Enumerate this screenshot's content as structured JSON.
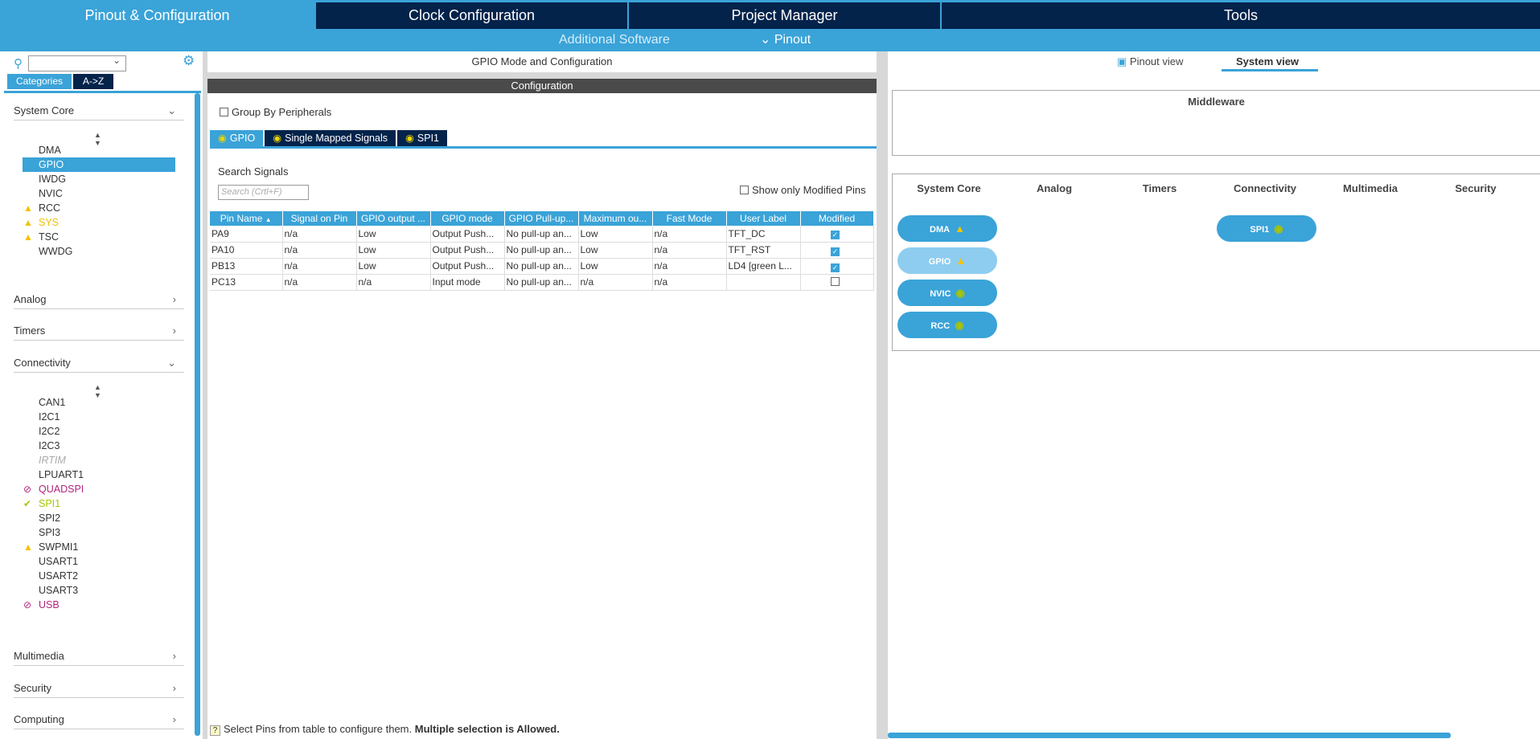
{
  "topnav": {
    "tabs": [
      "Pinout & Configuration",
      "Clock Configuration",
      "Project Manager",
      "Tools"
    ],
    "sub_additional": "Additional Software",
    "sub_pinout": "Pinout"
  },
  "left": {
    "categories_btn": "Categories",
    "az_btn": "A->Z",
    "system_core": {
      "label": "System Core",
      "items": [
        "DMA",
        "GPIO",
        "IWDG",
        "NVIC",
        "RCC",
        "SYS",
        "TSC",
        "WWDG"
      ]
    },
    "analog": "Analog",
    "timers": "Timers",
    "connectivity": {
      "label": "Connectivity",
      "items": [
        "CAN1",
        "I2C1",
        "I2C2",
        "I2C3",
        "IRTIM",
        "LPUART1",
        "QUADSPI",
        "SPI1",
        "SPI2",
        "SPI3",
        "SWPMI1",
        "USART1",
        "USART2",
        "USART3",
        "USB"
      ]
    },
    "multimedia": "Multimedia",
    "security": "Security",
    "computing": "Computing"
  },
  "mid": {
    "title": "GPIO Mode and Configuration",
    "config": "Configuration",
    "group_by": "Group By Peripherals",
    "tabs": [
      "GPIO",
      "Single Mapped Signals",
      "SPI1"
    ],
    "search_label": "Search Signals",
    "search_placeholder": "Search (Crtl+F)",
    "modified_only": "Show only Modified Pins",
    "columns": [
      "Pin Name",
      "Signal on Pin",
      "GPIO output ...",
      "GPIO mode",
      "GPIO Pull-up...",
      "Maximum ou...",
      "Fast Mode",
      "User Label",
      "Modified"
    ],
    "rows": [
      [
        "PA9",
        "n/a",
        "Low",
        "Output Push...",
        "No pull-up an...",
        "Low",
        "n/a",
        "TFT_DC"
      ],
      [
        "PA10",
        "n/a",
        "Low",
        "Output Push...",
        "No pull-up an...",
        "Low",
        "n/a",
        "TFT_RST"
      ],
      [
        "PB13",
        "n/a",
        "Low",
        "Output Push...",
        "No pull-up an...",
        "Low",
        "n/a",
        "LD4 [green L..."
      ],
      [
        "PC13",
        "n/a",
        "n/a",
        "Input mode",
        "No pull-up an...",
        "n/a",
        "n/a",
        ""
      ]
    ],
    "modified_checks": [
      true,
      true,
      true,
      false
    ],
    "hint_prefix": "Select Pins from table to configure them.",
    "hint_bold": "Multiple selection is Allowed."
  },
  "right": {
    "pinout_view": "Pinout view",
    "system_view": "System view",
    "middleware": "Middleware",
    "columns": [
      "System Core",
      "Analog",
      "Timers",
      "Connectivity",
      "Multimedia",
      "Security"
    ],
    "pills": {
      "dma": "DMA",
      "gpio": "GPIO",
      "nvic": "NVIC",
      "rcc": "RCC",
      "spi1": "SPI1"
    }
  },
  "colors": {
    "accent": "#3aa3d8",
    "dark": "#03234b",
    "warning": "#f3c300",
    "ok": "#a9c400",
    "disabled": "#b3237d"
  }
}
